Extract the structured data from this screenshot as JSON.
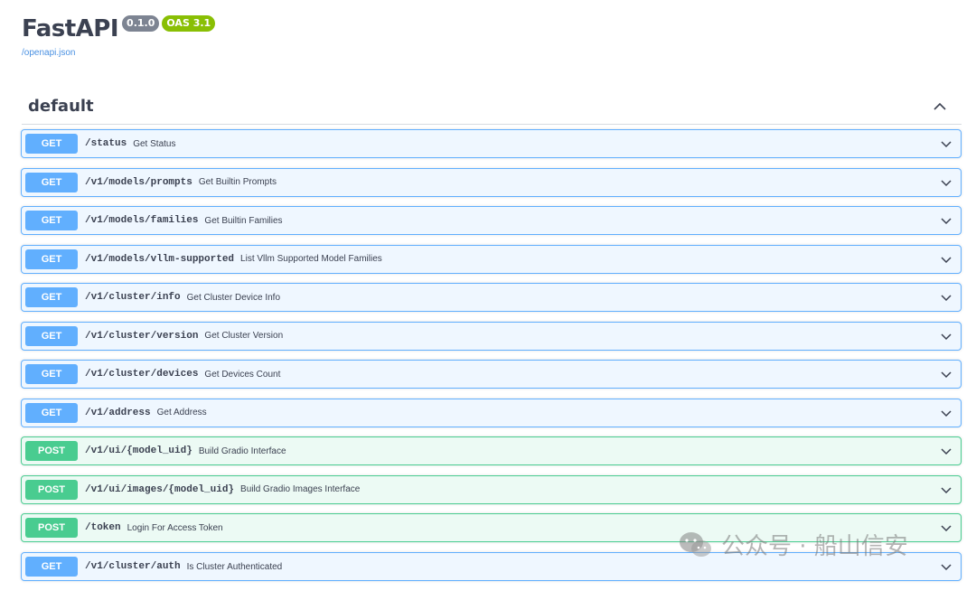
{
  "header": {
    "title": "FastAPI",
    "version_badge": "0.1.0",
    "oas_badge": "OAS 3.1",
    "spec_link": "/openapi.json"
  },
  "section": {
    "title": "default",
    "toggle_icon": "chevron-up-icon"
  },
  "operations": [
    {
      "method": "GET",
      "path": "/status",
      "summary": "Get Status"
    },
    {
      "method": "GET",
      "path": "/v1/models/prompts",
      "summary": "Get Builtin Prompts"
    },
    {
      "method": "GET",
      "path": "/v1/models/families",
      "summary": "Get Builtin Families"
    },
    {
      "method": "GET",
      "path": "/v1/models/vllm-supported",
      "summary": "List Vllm Supported Model Families"
    },
    {
      "method": "GET",
      "path": "/v1/cluster/info",
      "summary": "Get Cluster Device Info"
    },
    {
      "method": "GET",
      "path": "/v1/cluster/version",
      "summary": "Get Cluster Version"
    },
    {
      "method": "GET",
      "path": "/v1/cluster/devices",
      "summary": "Get Devices Count"
    },
    {
      "method": "GET",
      "path": "/v1/address",
      "summary": "Get Address"
    },
    {
      "method": "POST",
      "path": "/v1/ui/{model_uid}",
      "summary": "Build Gradio Interface"
    },
    {
      "method": "POST",
      "path": "/v1/ui/images/{model_uid}",
      "summary": "Build Gradio Images Interface"
    },
    {
      "method": "POST",
      "path": "/token",
      "summary": "Login For Access Token"
    },
    {
      "method": "GET",
      "path": "/v1/cluster/auth",
      "summary": "Is Cluster Authenticated"
    }
  ],
  "watermark": {
    "text": "公众号 · 船山信安",
    "icon": "wechat-icon"
  },
  "colors": {
    "get": "#61affe",
    "post": "#49cc90",
    "oas_badge": "#89bf04",
    "version_badge": "#7d8492",
    "link": "#4990e2",
    "text": "#3b4151"
  }
}
